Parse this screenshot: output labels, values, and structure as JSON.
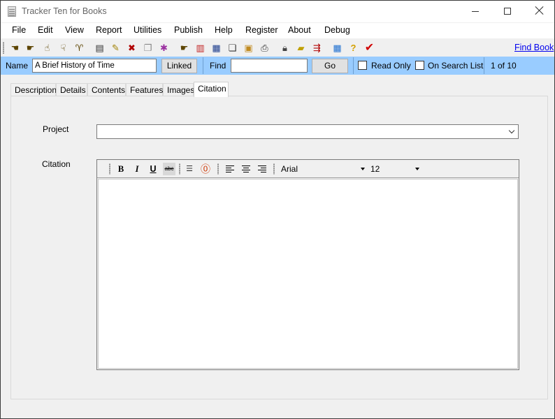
{
  "window": {
    "title": "Tracker Ten for Books",
    "icons": [
      "app-icon",
      "minimize-icon",
      "maximize-icon",
      "close-icon"
    ]
  },
  "menu": {
    "items": [
      "File",
      "Edit",
      "View",
      "Report",
      "Utilities",
      "Publish",
      "Help",
      "Register",
      "About",
      "Debug"
    ]
  },
  "toolbar": {
    "find_book_label": "Find Book",
    "icons": [
      "first-record-icon",
      "previous-record-icon",
      "next-record-icon",
      "last-record-icon",
      "filter-icon",
      "new-record-icon",
      "edit-record-icon",
      "delete-record-icon",
      "copy-record-icon",
      "sort-icon",
      "search-icon",
      "report-icon",
      "table-icon",
      "copy-icon",
      "image-icon",
      "print-icon",
      "lock-icon",
      "open-folder-icon",
      "export-icon",
      "calculator-icon",
      "help-icon",
      "checkmark-icon"
    ]
  },
  "recordbar": {
    "name_label": "Name",
    "name_value": "A Brief History of Time",
    "linked_label": "Linked",
    "find_label": "Find",
    "find_value": "",
    "go_label": "Go",
    "read_only_label": "Read Only",
    "on_search_list_label": "On Search List",
    "record_position": "1 of 10"
  },
  "tabs": {
    "items": [
      "Description",
      "Details",
      "Contents",
      "Features",
      "Images",
      "Citation"
    ],
    "active": "Citation"
  },
  "form": {
    "project_label": "Project",
    "project_value": "",
    "citation_label": "Citation",
    "citation_text": ""
  },
  "editor": {
    "font_name": "Arial",
    "font_size": "12",
    "buttons": [
      "bold-icon",
      "italic-icon",
      "underline-icon",
      "strikethrough-icon",
      "bullet-list-icon",
      "ordered-list-icon",
      "align-left-icon",
      "align-center-icon",
      "align-right-icon"
    ]
  },
  "colors": {
    "record_bar": "#99ccff",
    "link": "#0000ee",
    "window_bg": "#f0f0f0"
  }
}
